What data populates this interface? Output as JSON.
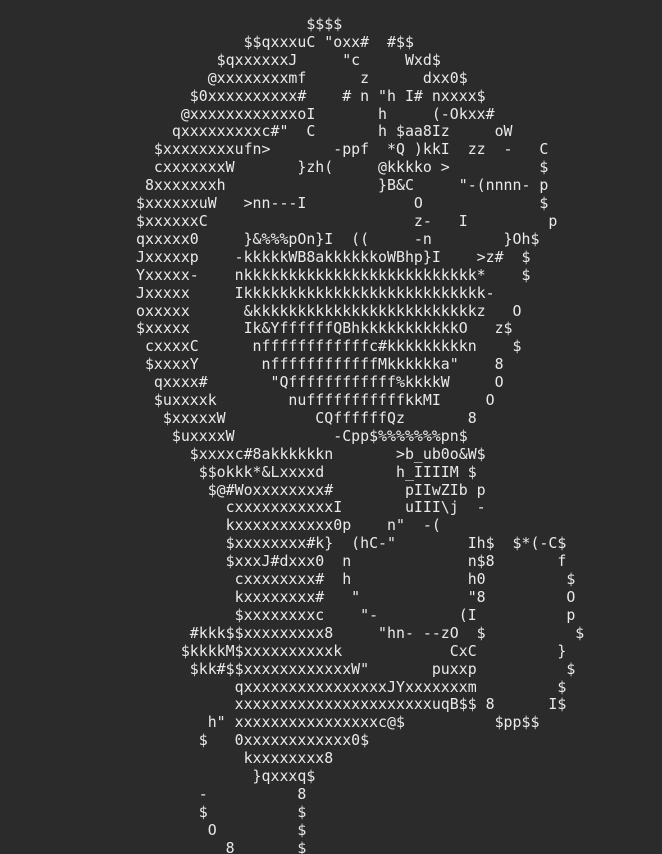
{
  "art": {
    "lines": [
      "                   $$$$",
      "            $$qxxxuC \"oxx#  #$$",
      "         $qxxxxxxJ     \"c     Wxd$",
      "        @xxxxxxxxmf      z      dxx0$",
      "      $0xxxxxxxxxx#    # n \"h I# nxxxx$",
      "     @xxxxxxxxxxxxoI       h     (-Okxx#",
      "    qxxxxxxxxxc#\"  C       h $aa8Iz     oW",
      "  $xxxxxxxxufn>       -ppf  *Q )kkI  zz  -   C",
      "  cxxxxxxxW       }zh(     @kkkko >          $",
      " 8xxxxxxxh                 }B&C     \"-(nnnn- p",
      "$xxxxxxuW   >nn---I            O             $",
      "$xxxxxxC                       z-   I         p",
      "qxxxxx0     }&%%%pOn}I  ((     -n        }Oh$",
      "Jxxxxxp    -kkkkkWB8akkkkkkoWBhp}I    >z#  $",
      "Yxxxxx-    nkkkkkkkkkkkkkkkkkkkkkkkkkk*    $",
      "Jxxxxx     Ikkkkkkkkkkkkkkkkkkkkkkkkkkk-",
      "oxxxxx      &kkkkkkkkkkkkkkkkkkkkkkkkkz   O",
      "$xxxxx      Ik&YffffffQBhkkkkkkkkkkkO   z$",
      " cxxxxC      nffffffffffffc#kkkkkkkkkn    $",
      " $xxxxY       nffffffffffffMkkkkkka\"    8",
      "  qxxxx#       \"Qffffffffffff%kkkkW     O",
      "  $uxxxxk        nufffffffffffkkMI     O",
      "   $xxxxxW          CQffffffQz       8",
      "    $uxxxxW           -Cpp$%%%%%%%pn$",
      "      $xxxxc#8akkkkkkn       >b_ub0o&W$",
      "       $$okkk*&Lxxxxd        h_IIIIM $",
      "        $@#Woxxxxxxxx#        pIIwZIb p",
      "          cxxxxxxxxxxxI       uIII\\j  -",
      "          kxxxxxxxxxxx0p    n\"  -(",
      "          $xxxxxxxx#k}  (hC-\"        Ih$  $*(-C$",
      "          $xxxJ#dxxx0  n             n$8       f",
      "           cxxxxxxxx#  h             h0         $",
      "           kxxxxxxxx#   \"            \"8         O",
      "           $xxxxxxxxc    \"-         (I          p",
      "      #kkk$$xxxxxxxxx8     \"hn- --zO  $          $",
      "     $kkkkM$xxxxxxxxxxk            CxC         }",
      "      $kk#$$xxxxxxxxxxxxW\"       puxxp          $",
      "           qxxxxxxxxxxxxxxxxJYxxxxxxxm         $",
      "           xxxxxxxxxxxxxxxxxxxxxxuqB$$ 8      I$",
      "        h\" xxxxxxxxxxxxxxxxc@$          $pp$$",
      "       $   0xxxxxxxxxxxx0$",
      "            kxxxxxxxx8",
      "             }qxxxq$",
      "       -          8",
      "       $          $",
      "        O         $",
      "          8       $",
      "             $$$"
    ]
  }
}
